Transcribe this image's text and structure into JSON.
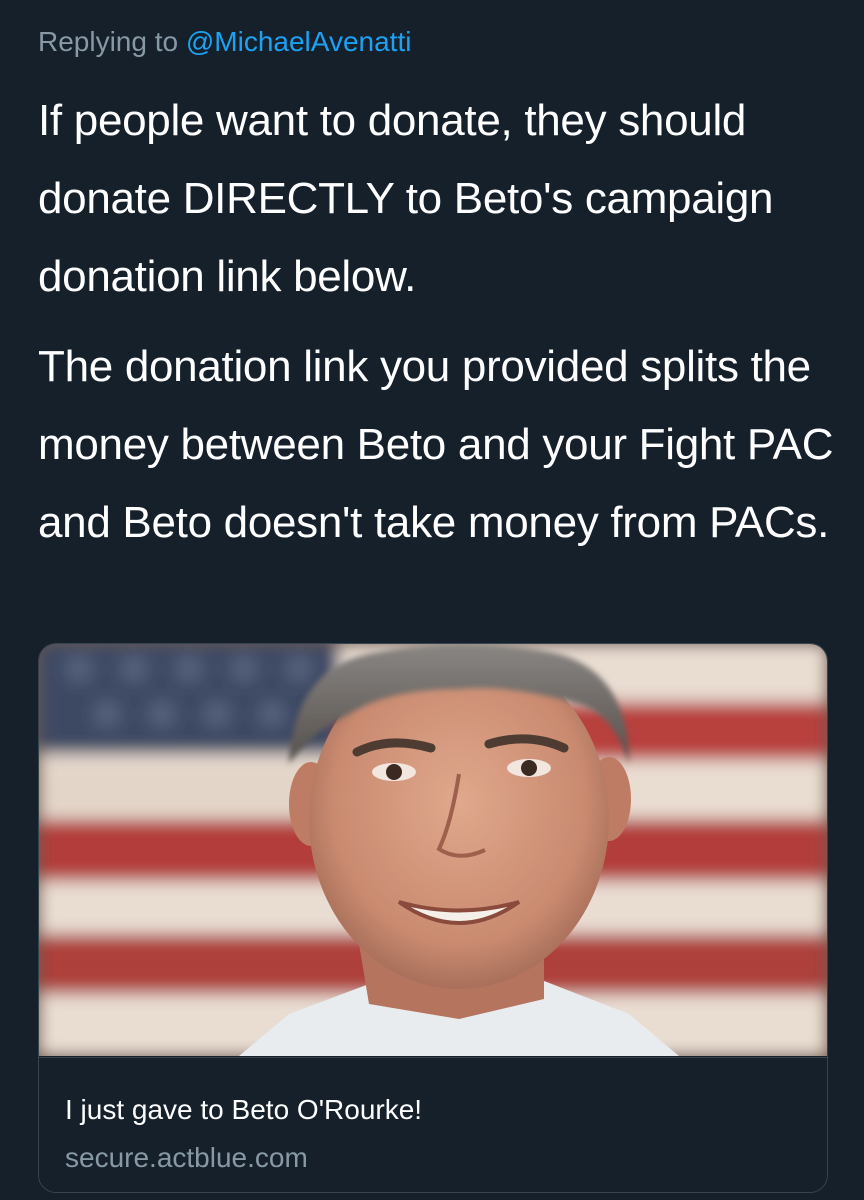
{
  "reply": {
    "prefix": "Replying to ",
    "mention": "@MichaelAvenatti"
  },
  "tweet": {
    "paragraphs": [
      "If people want to donate, they should donate DIRECTLY to Beto's campaign donation link below.",
      "The donation link you provided splits the money between Beto and your Fight PAC and Beto doesn't take money from PACs."
    ]
  },
  "link_card": {
    "title": "I just gave to Beto O'Rourke!",
    "domain": "secure.actblue.com"
  },
  "colors": {
    "background": "#15202b",
    "text": "#ffffff",
    "secondary_text": "#8899a6",
    "link": "#1da1f2",
    "border": "#38444d"
  }
}
